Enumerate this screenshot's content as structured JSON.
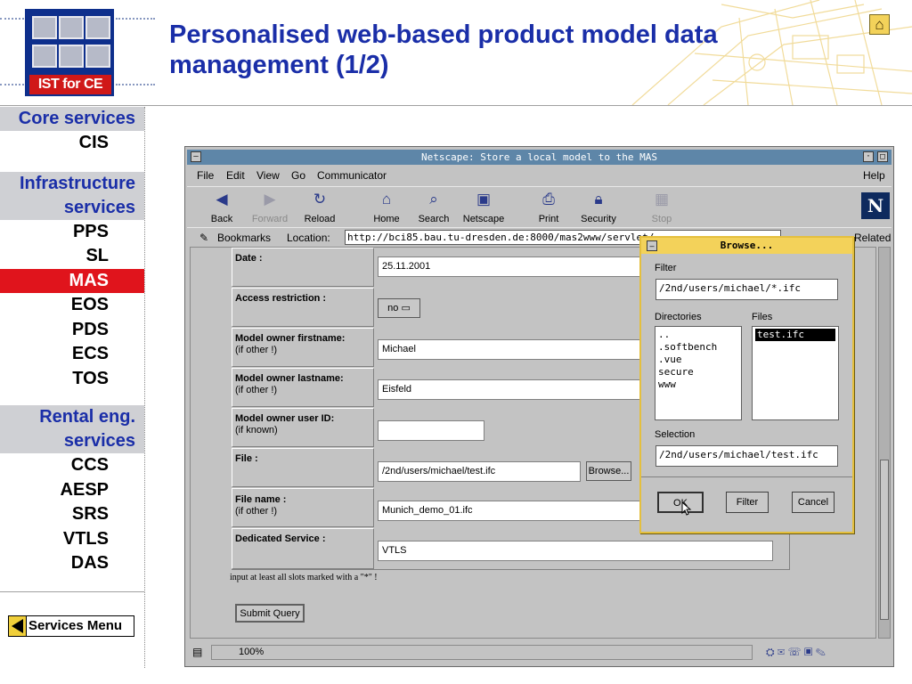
{
  "slide": {
    "title": "Personalised web-based product model data management (1/2)",
    "logo_text": "IST for CE",
    "home_icon": "home-icon"
  },
  "nav": {
    "sections": [
      {
        "title": "Core services",
        "items": [
          "CIS"
        ]
      },
      {
        "title": "Infrastructure services",
        "items": [
          "PPS",
          "SL",
          "MAS",
          "EOS",
          "PDS",
          "ECS",
          "TOS"
        ]
      },
      {
        "title": "Rental eng. services",
        "items": [
          "CCS",
          "AESP",
          "SRS",
          "VTLS",
          "DAS"
        ]
      }
    ],
    "active": "MAS",
    "services_menu": "Services Menu"
  },
  "browser": {
    "window_title": "Netscape: Store a local model to the MAS",
    "menu": [
      "File",
      "Edit",
      "View",
      "Go",
      "Communicator",
      "Help"
    ],
    "toolbar": [
      "Back",
      "Forward",
      "Reload",
      "Home",
      "Search",
      "Netscape",
      "Print",
      "Security",
      "Stop"
    ],
    "bookmarks_label": "Bookmarks",
    "location_label": "Location:",
    "location_url": "http://bci85.bau.tu-dresden.de:8000/mas2www/servlet/",
    "related_label": "Related",
    "status_zoom": "100%"
  },
  "form": {
    "rows": [
      {
        "label": "Date :",
        "sub": "",
        "value": "25.11.2001"
      },
      {
        "label": "Access restriction :",
        "sub": "",
        "value": "no"
      },
      {
        "label": "Model owner firstname:",
        "sub": "(if other !)",
        "value": "Michael"
      },
      {
        "label": "Model owner lastname:",
        "sub": "(if other !)",
        "value": "Eisfeld"
      },
      {
        "label": "Model owner user ID:",
        "sub": "(if known)",
        "value": ""
      },
      {
        "label": "File :",
        "sub": "",
        "value": "/2nd/users/michael/test.ifc"
      },
      {
        "label": "File name :",
        "sub": "(if other !)",
        "value": "Munich_demo_01.ifc"
      },
      {
        "label": "Dedicated Service :",
        "sub": "",
        "value": "VTLS"
      }
    ],
    "browse_button": "Browse...",
    "note": "input at least all slots marked with a \"*\" !",
    "submit": "Submit Query"
  },
  "dialog": {
    "title": "Browse...",
    "filter_label": "Filter",
    "filter_value": "/2nd/users/michael/*.ifc",
    "directories_label": "Directories",
    "directories": [
      "..",
      ".softbench",
      ".vue",
      "secure",
      "www"
    ],
    "files_label": "Files",
    "files": [
      "test.ifc"
    ],
    "selection_label": "Selection",
    "selection_value": "/2nd/users/michael/test.ifc",
    "ok": "OK",
    "filter_button": "Filter",
    "cancel": "Cancel"
  },
  "colors": {
    "title_blue": "#1a2ea8",
    "active_red": "#e0141c",
    "section_grey": "#cfd0d4",
    "dialog_border": "#e4bf3e"
  }
}
